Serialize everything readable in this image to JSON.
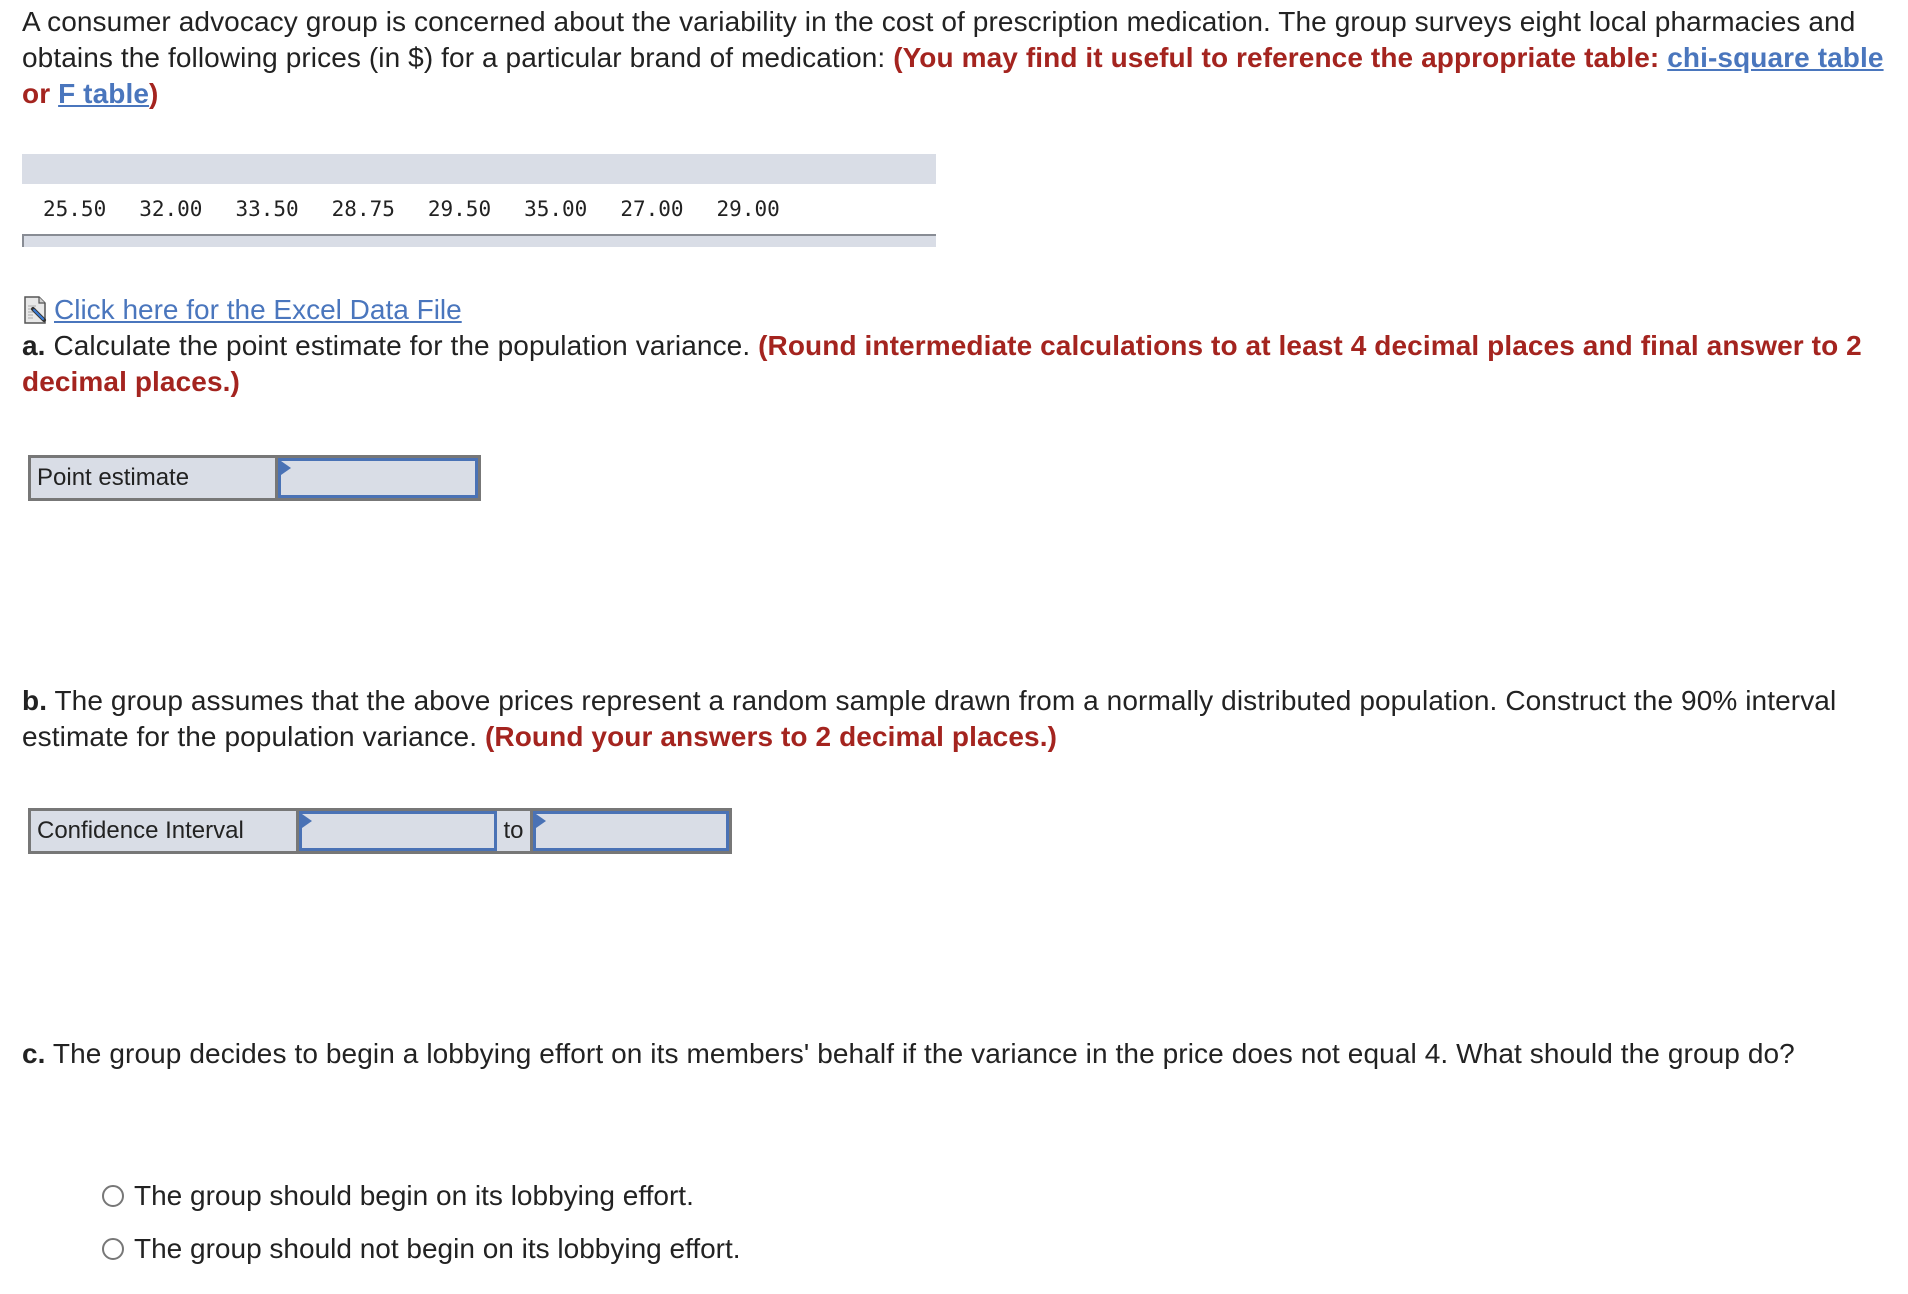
{
  "intro": {
    "text": "A consumer advocacy group is concerned about the variability in the cost of prescription medication. The group surveys eight local pharmacies and obtains the following prices (in $) for a particular brand of medication: ",
    "red_prefix": "(You may find it useful to reference the appropriate table: ",
    "link_chi": "chi-square table",
    "or": " or ",
    "link_f": "F table",
    "red_suffix": ")"
  },
  "prices": [
    "25.50",
    "32.00",
    "33.50",
    "28.75",
    "29.50",
    "35.00",
    "27.00",
    "29.00"
  ],
  "excel_link": {
    "icon": "excel-file-icon",
    "label": "Click here for the Excel Data File"
  },
  "part_a": {
    "letter": "a.",
    "text": " Calculate the point estimate for the population variance. ",
    "instruction": "(Round intermediate calculations to at least 4 decimal places and final answer to 2 decimal places.)",
    "label": "Point estimate",
    "value": ""
  },
  "part_b": {
    "letter": "b.",
    "text": " The group assumes that the above prices represent a random sample drawn from a normally distributed population. Construct the 90% interval estimate for the population variance. ",
    "instruction": "(Round your answers to 2 decimal places.)",
    "label": "Confidence Interval",
    "to": "to",
    "lower_value": "",
    "upper_value": ""
  },
  "part_c": {
    "letter": "c.",
    "text": " The group decides to begin a lobbying effort on its members' behalf if the variance in the price does not equal 4. What should the group do?",
    "options": [
      "The group should begin on its lobbying effort.",
      "The group should not begin on its lobbying effort."
    ]
  },
  "colors": {
    "instruction_red": "#a4241f",
    "link_blue": "#4a76bd",
    "input_border": "#4a72b5",
    "table_bg": "#d9dde6"
  }
}
